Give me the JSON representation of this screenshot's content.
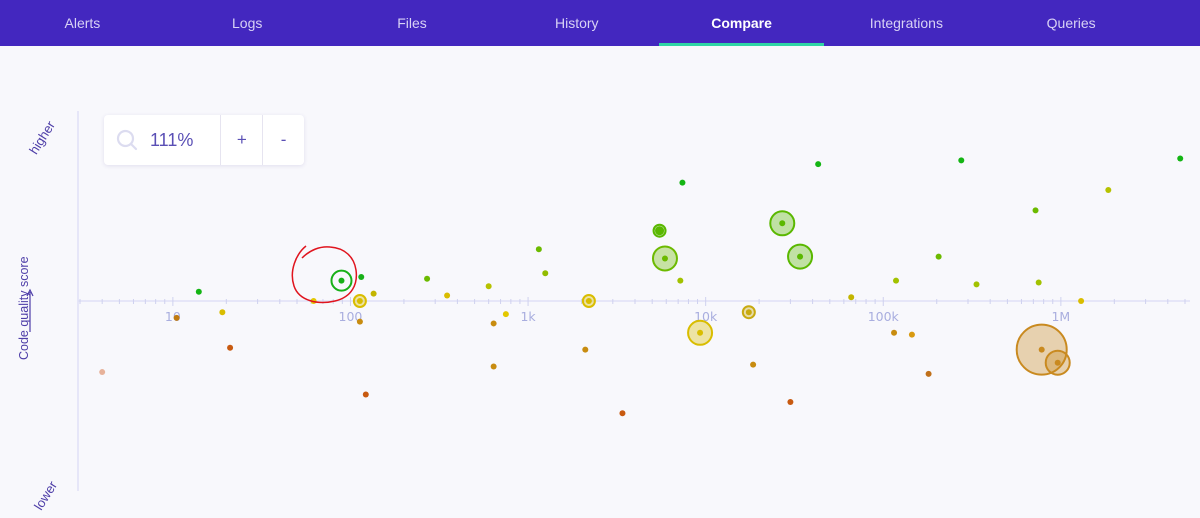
{
  "nav": {
    "tabs": [
      {
        "label": "Alerts",
        "active": false
      },
      {
        "label": "Logs",
        "active": false
      },
      {
        "label": "Files",
        "active": false
      },
      {
        "label": "History",
        "active": false
      },
      {
        "label": "Compare",
        "active": true
      },
      {
        "label": "Integrations",
        "active": false
      },
      {
        "label": "Queries",
        "active": false
      }
    ]
  },
  "zoom": {
    "value": "111%",
    "plus_label": "+",
    "minus_label": "-"
  },
  "y_axis": {
    "high_label": "higher",
    "low_label": "lower",
    "title": "Code quality score"
  },
  "colors": {
    "nav_bg": "#4327bf",
    "active_underline": "#2fd5a5",
    "axis": "#dfe0f6",
    "annotation": "#e0141e"
  },
  "chart_data": {
    "type": "scatter",
    "x_scale": "log",
    "xlim": [
      3,
      5000000
    ],
    "ylim": [
      -1,
      1
    ],
    "x_tick_labels": [
      "10",
      "100",
      "1k",
      "10k",
      "100k",
      "1M"
    ],
    "x_tick_values": [
      10,
      100,
      1000,
      10000,
      100000,
      1000000
    ],
    "ylabel": "Code quality score",
    "grid": false,
    "points": [
      {
        "x": 14,
        "y": 0.05,
        "size": 1,
        "color": "#14b514"
      },
      {
        "x": 19,
        "y": -0.06,
        "size": 1,
        "color": "#d9bd00"
      },
      {
        "x": 10.5,
        "y": -0.09,
        "size": 1,
        "color": "#c07a10"
      },
      {
        "x": 21,
        "y": -0.25,
        "size": 1,
        "color": "#c85a10"
      },
      {
        "x": 4,
        "y": -0.38,
        "size": 1,
        "color": "#e7b29a"
      },
      {
        "x": 62,
        "y": 0.0,
        "size": 1,
        "color": "#e3c800"
      },
      {
        "x": 89,
        "y": 0.11,
        "size": 1,
        "color": "#18b018",
        "highlight": true
      },
      {
        "x": 115,
        "y": 0.13,
        "size": 1,
        "color": "#18b018"
      },
      {
        "x": 113,
        "y": 0.0,
        "size": 2,
        "color": "#d9bd00"
      },
      {
        "x": 135,
        "y": 0.04,
        "size": 1,
        "color": "#c3b500"
      },
      {
        "x": 113,
        "y": -0.11,
        "size": 1,
        "color": "#c88c10"
      },
      {
        "x": 122,
        "y": -0.5,
        "size": 1,
        "color": "#c85a10"
      },
      {
        "x": 270,
        "y": 0.12,
        "size": 1,
        "color": "#6cba00"
      },
      {
        "x": 350,
        "y": 0.03,
        "size": 1,
        "color": "#d9bd00"
      },
      {
        "x": 600,
        "y": 0.08,
        "size": 1,
        "color": "#b6c200"
      },
      {
        "x": 750,
        "y": -0.07,
        "size": 1,
        "color": "#e3c800"
      },
      {
        "x": 640,
        "y": -0.12,
        "size": 1,
        "color": "#c88c10"
      },
      {
        "x": 640,
        "y": -0.35,
        "size": 1,
        "color": "#c88c10"
      },
      {
        "x": 1150,
        "y": 0.28,
        "size": 1,
        "color": "#6cba00"
      },
      {
        "x": 1250,
        "y": 0.15,
        "size": 1,
        "color": "#92bc00"
      },
      {
        "x": 2200,
        "y": 0.0,
        "size": 2,
        "color": "#d9bd00"
      },
      {
        "x": 2100,
        "y": -0.26,
        "size": 1,
        "color": "#c88c10"
      },
      {
        "x": 3400,
        "y": -0.6,
        "size": 1,
        "color": "#c85a10"
      },
      {
        "x": 5500,
        "y": 0.38,
        "size": 2,
        "color": "#5ab800"
      },
      {
        "x": 5900,
        "y": 0.23,
        "size": 3,
        "color": "#6cba00"
      },
      {
        "x": 7200,
        "y": 0.11,
        "size": 1,
        "color": "#a2c200"
      },
      {
        "x": 7400,
        "y": 0.64,
        "size": 1,
        "color": "#14b514"
      },
      {
        "x": 9300,
        "y": -0.17,
        "size": 3,
        "color": "#d9bd00"
      },
      {
        "x": 17500,
        "y": -0.06,
        "size": 2,
        "color": "#c8aa10"
      },
      {
        "x": 18500,
        "y": -0.34,
        "size": 1,
        "color": "#c88c10"
      },
      {
        "x": 27000,
        "y": 0.42,
        "size": 3,
        "color": "#5ab800"
      },
      {
        "x": 34000,
        "y": 0.24,
        "size": 3,
        "color": "#5ab800"
      },
      {
        "x": 30000,
        "y": -0.54,
        "size": 1,
        "color": "#c85a10"
      },
      {
        "x": 43000,
        "y": 0.74,
        "size": 1,
        "color": "#14b514"
      },
      {
        "x": 66000,
        "y": 0.02,
        "size": 1,
        "color": "#c3b500"
      },
      {
        "x": 115000,
        "y": -0.17,
        "size": 1,
        "color": "#c88c10"
      },
      {
        "x": 118000,
        "y": 0.11,
        "size": 1,
        "color": "#a2c200"
      },
      {
        "x": 145000,
        "y": -0.18,
        "size": 1,
        "color": "#d99a10"
      },
      {
        "x": 180000,
        "y": -0.39,
        "size": 1,
        "color": "#c0701a"
      },
      {
        "x": 205000,
        "y": 0.24,
        "size": 1,
        "color": "#6cba00"
      },
      {
        "x": 275000,
        "y": 0.76,
        "size": 1,
        "color": "#14b514"
      },
      {
        "x": 335000,
        "y": 0.09,
        "size": 1,
        "color": "#a2c200"
      },
      {
        "x": 720000,
        "y": 0.49,
        "size": 1,
        "color": "#6cba00"
      },
      {
        "x": 750000,
        "y": 0.1,
        "size": 1,
        "color": "#a2c200"
      },
      {
        "x": 780000,
        "y": -0.26,
        "size": 5,
        "color": "#c98a20"
      },
      {
        "x": 960000,
        "y": -0.33,
        "size": 3,
        "color": "#c98a20"
      },
      {
        "x": 1300000,
        "y": 0.0,
        "size": 1,
        "color": "#d9bd00"
      },
      {
        "x": 1850000,
        "y": 0.6,
        "size": 1,
        "color": "#b6c200"
      },
      {
        "x": 4700000,
        "y": 0.77,
        "size": 1,
        "color": "#14b514"
      }
    ]
  }
}
